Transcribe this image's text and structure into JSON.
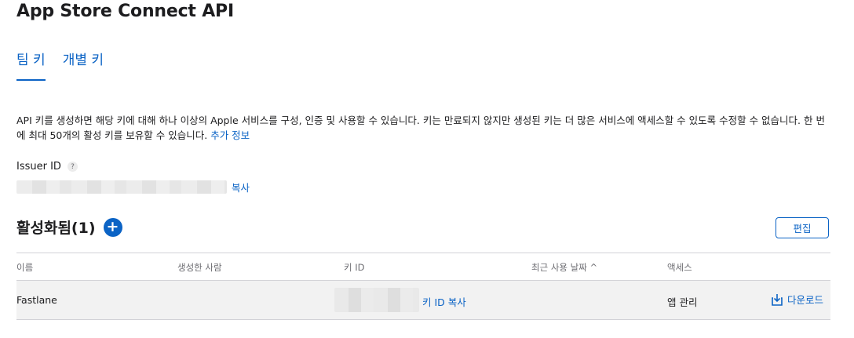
{
  "page": {
    "title": "App Store Connect API"
  },
  "tabs": [
    {
      "label": "팀 키",
      "active": true
    },
    {
      "label": "개별 키",
      "active": false
    }
  ],
  "description": {
    "text": "API 키를 생성하면 해당 키에 대해 하나 이상의 Apple 서비스를 구성, 인증 및 사용할 수 있습니다. 키는 만료되지 않지만 생성된 키는 더 많은 서비스에 액세스할 수 있도록 수정할 수 없습니다. 한 번에 최대 50개의 활성 키를 보유할 수 있습니다.",
    "link": "추가 정보"
  },
  "issuer": {
    "label": "Issuer ID",
    "help": "?",
    "copy_label": "복사"
  },
  "active_section": {
    "title": "활성화됨(1)",
    "add_symbol": "+",
    "edit_label": "편집"
  },
  "table": {
    "headers": [
      "이름",
      "생성한 사람",
      "키 ID",
      "최근 사용 날짜 ^",
      "액세스"
    ],
    "rows": [
      {
        "name": "Fastlane",
        "created_by": "",
        "key_copy": "키 ID 복사",
        "last_used": "",
        "access": "앱 관리",
        "download": "다운로드"
      }
    ]
  },
  "colors": {
    "accent": "#0b63c5",
    "row_bg": "#f2f2f2",
    "border": "#d2d2d7"
  }
}
